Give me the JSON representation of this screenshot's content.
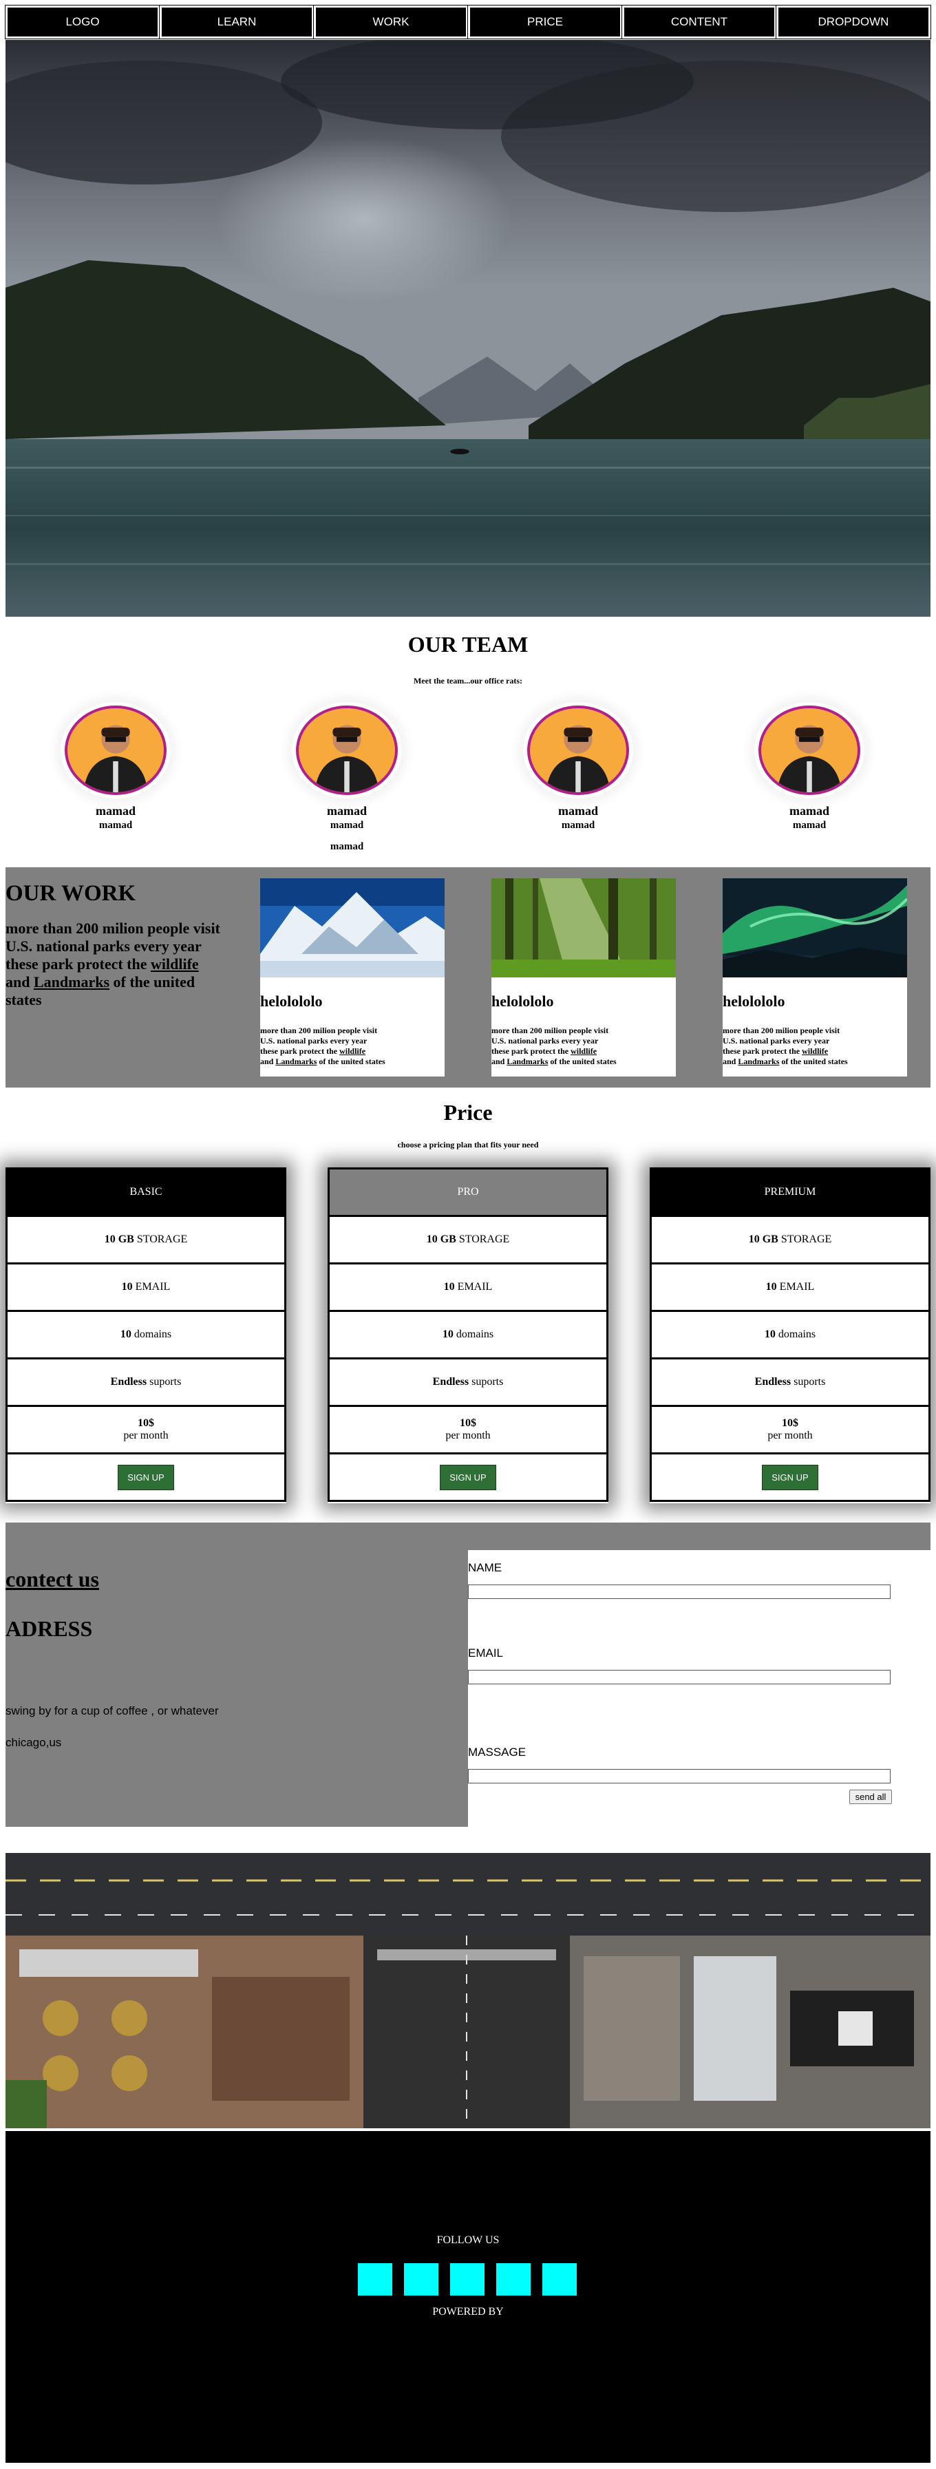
{
  "nav": {
    "items": [
      "LOGO",
      "LEARN",
      "WORK",
      "PRICE",
      "CONTENT",
      "DROPDOWN"
    ]
  },
  "team": {
    "title": "OUR TEAM",
    "subtitle": "Meet the team...our office rats:",
    "members": [
      {
        "name": "mamad",
        "role": "mamad"
      },
      {
        "name": "mamad",
        "role": "mamad",
        "extra": "mamad"
      },
      {
        "name": "mamad",
        "role": "mamad"
      },
      {
        "name": "mamad",
        "role": "mamad"
      }
    ]
  },
  "work": {
    "title": "OUR WORK",
    "line1": "more than 200 milion people visit",
    "line2": "U.S. national parks every year",
    "line3_pre": "these park protect the ",
    "wildlife": "wildlife",
    "line4_pre": "and ",
    "landmarks": "Landmarks",
    "line4_post": " of the united",
    "line5": "states",
    "cards": [
      {
        "title": "helolololo",
        "t1": "more than 200 milion people visit",
        "t2": "U.S. national parks every year",
        "t3": "these park protect the ",
        "wildlife": "wildlife",
        "t4": "and ",
        "landmarks": "Landmarks",
        "t5": " of the united states",
        "image": "snow-mountain-image"
      },
      {
        "title": "helolololo",
        "t1": "more than 200 milion people visit",
        "t2": "U.S. national parks every year",
        "t3": "these park protect the ",
        "wildlife": "wildlife",
        "t4": "and ",
        "landmarks": "Landmarks",
        "t5": " of the united states",
        "image": "forest-image"
      },
      {
        "title": "helolololo",
        "t1": "more than 200 milion people visit",
        "t2": "U.S. national parks every year",
        "t3": "these park protect the ",
        "wildlife": "wildlife",
        "t4": "and ",
        "landmarks": "Landmarks",
        "t5": " of the united states",
        "image": "aurora-image"
      }
    ]
  },
  "price": {
    "title": "Price",
    "subtitle": "choose a pricing plan that fits your need",
    "plans": [
      {
        "name": "BASIC",
        "head_color": "#000000",
        "storage_num": "10 GB",
        "storage_label": " STORAGE",
        "email_num": "10",
        "email_label": " EMAIL",
        "domains_num": "10",
        "domains_label": " domains",
        "support_num": "Endless",
        "support_label": " suports",
        "price": "10$",
        "period": "per month",
        "button": "SIGN UP"
      },
      {
        "name": "PRO",
        "head_color": "#808080",
        "storage_num": "10 GB",
        "storage_label": " STORAGE",
        "email_num": "10",
        "email_label": " EMAIL",
        "domains_num": "10",
        "domains_label": " domains",
        "support_num": "Endless",
        "support_label": " suports",
        "price": "10$",
        "period": "per month",
        "button": "SIGN UP"
      },
      {
        "name": "PREMIUM",
        "head_color": "#000000",
        "storage_num": "10 GB",
        "storage_label": " STORAGE",
        "email_num": "10",
        "email_label": " EMAIL",
        "domains_num": "10",
        "domains_label": " domains",
        "support_num": "Endless",
        "support_label": " suports",
        "price": "10$",
        "period": "per month",
        "button": "SIGN UP"
      }
    ]
  },
  "contact": {
    "title": "contect us",
    "adress": "ADRESS",
    "line1": "swing by for a cup of coffee , or whatever",
    "line2": "chicago,us",
    "form": {
      "name_label": "NAME",
      "email_label": "EMAIL",
      "message_label": "MASSAGE",
      "send": "send all"
    }
  },
  "footer": {
    "follow": "FOLLOW US",
    "powered": "POWERED BY",
    "social_color": "#00ffff",
    "social_count": 5
  },
  "colors": {
    "nav_bg": "#000000",
    "section_gray": "#808080",
    "signup_green": "#2e6f36",
    "avatar_ring": "#b01f8c",
    "avatar_bg": "#f7a93b"
  }
}
